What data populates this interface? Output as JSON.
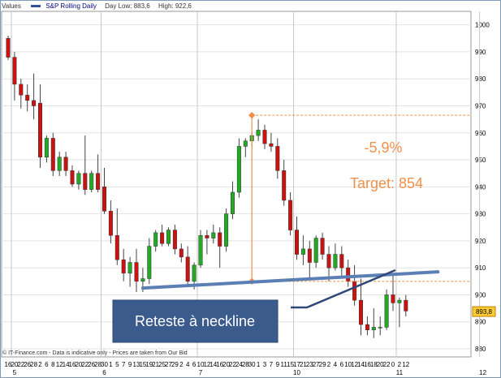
{
  "legend": {
    "values_label": "Values",
    "series_name": "S&P Rolling Daily",
    "day_low": "Day Low: 883,6",
    "high": "High: 922,6"
  },
  "footer": "© IT-Finance.com - Data is indicative only - Prices are taken from Our Bid",
  "chart_data": {
    "type": "candlestick",
    "ylim": [
      877,
      1005
    ],
    "y_ticks": [
      880,
      890,
      900,
      910,
      920,
      930,
      940,
      950,
      960,
      970,
      980,
      990,
      1000
    ],
    "x_day_labels": [
      "16",
      "20",
      "22",
      "26",
      "28",
      "2",
      "6",
      "8",
      "12",
      "14",
      "16",
      "20",
      "22",
      "26",
      "28",
      "30",
      "1",
      "5",
      "7",
      "9",
      "13",
      "15",
      "19",
      "21",
      "25",
      "27",
      "29",
      "2",
      "4",
      "6",
      "10",
      "12",
      "14",
      "16",
      "20",
      "22",
      "24",
      "28",
      "30",
      "1",
      "3",
      "7",
      "9",
      "11",
      "15",
      "17",
      "21",
      "23",
      "27",
      "29",
      "2",
      "4",
      "6",
      "10",
      "12",
      "14",
      "16",
      "18",
      "20",
      "22",
      "0",
      "2",
      "12"
    ],
    "x_month_labels": [
      {
        "label": "5",
        "index": 1
      },
      {
        "label": "6",
        "index": 15
      },
      {
        "label": "7",
        "index": 30
      },
      {
        "label": "10",
        "index": 45
      },
      {
        "label": "11",
        "index": 61
      },
      {
        "label": "12",
        "index": 74
      }
    ],
    "candles": [
      {
        "o": 995,
        "h": 996,
        "c": 988,
        "l": 987
      },
      {
        "o": 988,
        "h": 990,
        "c": 978,
        "l": 972
      },
      {
        "o": 978,
        "h": 980,
        "c": 974,
        "l": 969
      },
      {
        "o": 974,
        "h": 978,
        "c": 972,
        "l": 968
      },
      {
        "o": 972,
        "h": 982,
        "c": 970,
        "l": 965
      },
      {
        "o": 971,
        "h": 978,
        "c": 951,
        "l": 947
      },
      {
        "o": 951,
        "h": 959,
        "c": 958,
        "l": 949
      },
      {
        "o": 958,
        "h": 960,
        "c": 946,
        "l": 944
      },
      {
        "o": 946,
        "h": 953,
        "c": 951,
        "l": 944
      },
      {
        "o": 951,
        "h": 953,
        "c": 946,
        "l": 944
      },
      {
        "o": 946,
        "h": 948,
        "c": 941,
        "l": 940
      },
      {
        "o": 941,
        "h": 946,
        "c": 945,
        "l": 939
      },
      {
        "o": 945,
        "h": 959,
        "c": 939,
        "l": 937
      },
      {
        "o": 939,
        "h": 946,
        "c": 945,
        "l": 938
      },
      {
        "o": 945,
        "h": 952,
        "c": 939,
        "l": 938
      },
      {
        "o": 940,
        "h": 947,
        "c": 931,
        "l": 930
      },
      {
        "o": 931,
        "h": 935,
        "c": 922,
        "l": 919
      },
      {
        "o": 922,
        "h": 932,
        "c": 913,
        "l": 911
      },
      {
        "o": 913,
        "h": 917,
        "c": 908,
        "l": 905
      },
      {
        "o": 908,
        "h": 914,
        "c": 912,
        "l": 903
      },
      {
        "o": 912,
        "h": 917,
        "c": 905,
        "l": 901
      },
      {
        "o": 905,
        "h": 910,
        "c": 906,
        "l": 901
      },
      {
        "o": 906,
        "h": 921,
        "c": 918,
        "l": 904
      },
      {
        "o": 918,
        "h": 924,
        "c": 923,
        "l": 916
      },
      {
        "o": 923,
        "h": 926,
        "c": 919,
        "l": 918
      },
      {
        "o": 919,
        "h": 925,
        "c": 924,
        "l": 918
      },
      {
        "o": 924,
        "h": 926,
        "c": 917,
        "l": 915
      },
      {
        "o": 917,
        "h": 919,
        "c": 914,
        "l": 912
      },
      {
        "o": 914,
        "h": 918,
        "c": 905,
        "l": 904
      },
      {
        "o": 905,
        "h": 912,
        "c": 911,
        "l": 902
      },
      {
        "o": 911,
        "h": 924,
        "c": 922,
        "l": 910
      },
      {
        "o": 922,
        "h": 924,
        "c": 921,
        "l": 915
      },
      {
        "o": 921,
        "h": 926,
        "c": 923,
        "l": 919
      },
      {
        "o": 923,
        "h": 925,
        "c": 918,
        "l": 910
      },
      {
        "o": 918,
        "h": 932,
        "c": 930,
        "l": 916
      },
      {
        "o": 930,
        "h": 942,
        "c": 938,
        "l": 928
      },
      {
        "o": 938,
        "h": 958,
        "c": 955,
        "l": 936
      },
      {
        "o": 955,
        "h": 958,
        "c": 957,
        "l": 951
      },
      {
        "o": 957,
        "h": 960,
        "c": 959,
        "l": 955
      },
      {
        "o": 959,
        "h": 965,
        "c": 961,
        "l": 957
      },
      {
        "o": 961,
        "h": 963,
        "c": 956,
        "l": 954
      },
      {
        "o": 956,
        "h": 960,
        "c": 955,
        "l": 953
      },
      {
        "o": 955,
        "h": 958,
        "c": 946,
        "l": 943
      },
      {
        "o": 946,
        "h": 950,
        "c": 935,
        "l": 933
      },
      {
        "o": 935,
        "h": 938,
        "c": 924,
        "l": 922
      },
      {
        "o": 924,
        "h": 929,
        "c": 915,
        "l": 913
      },
      {
        "o": 915,
        "h": 922,
        "c": 917,
        "l": 911
      },
      {
        "o": 917,
        "h": 920,
        "c": 912,
        "l": 906
      },
      {
        "o": 912,
        "h": 922,
        "c": 921,
        "l": 910
      },
      {
        "o": 921,
        "h": 923,
        "c": 915,
        "l": 913
      },
      {
        "o": 915,
        "h": 918,
        "c": 910,
        "l": 905
      },
      {
        "o": 910,
        "h": 919,
        "c": 915,
        "l": 909
      },
      {
        "o": 915,
        "h": 918,
        "c": 910,
        "l": 907
      },
      {
        "o": 910,
        "h": 913,
        "c": 905,
        "l": 903
      },
      {
        "o": 905,
        "h": 911,
        "c": 898,
        "l": 896
      },
      {
        "o": 898,
        "h": 906,
        "c": 889,
        "l": 885
      },
      {
        "o": 889,
        "h": 892,
        "c": 887,
        "l": 885
      },
      {
        "o": 887,
        "h": 895,
        "c": 888,
        "l": 884
      },
      {
        "o": 888,
        "h": 892,
        "c": 888,
        "l": 885
      },
      {
        "o": 888,
        "h": 902,
        "c": 900,
        "l": 887
      },
      {
        "o": 900,
        "h": 908,
        "c": 897,
        "l": 894
      },
      {
        "o": 897,
        "h": 899,
        "c": 898,
        "l": 888
      },
      {
        "o": 898,
        "h": 900,
        "c": 894,
        "l": 892
      }
    ],
    "last_price": "893,8",
    "colors": {
      "up": "#22aa22",
      "down": "#cc1111",
      "annotation": "#f0904a",
      "neckline": "#5b7fb4",
      "callout_bg": "#3b5b8c"
    },
    "annotations": {
      "percent_text": "-5,9%",
      "target_text": "Target: 854",
      "callout_text": "Reteste à neckline",
      "peak_level": 966.5,
      "neckline_level": 905,
      "neckline": {
        "start_index": 21,
        "start_value": 902.5,
        "end_index": 67,
        "end_value": 908.5
      }
    }
  }
}
